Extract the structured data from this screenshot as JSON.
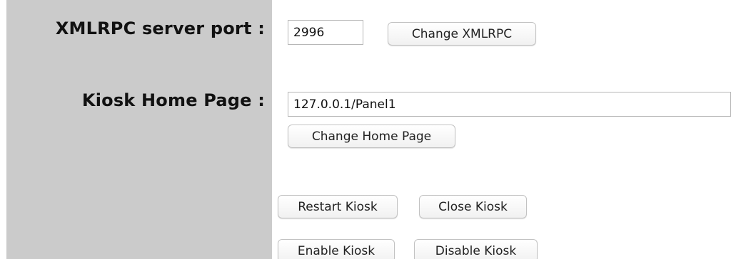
{
  "settings": {
    "xmlrpc_port": {
      "label": "XMLRPC server port :",
      "value": "2996",
      "button_label": "Change XMLRPC"
    },
    "home_page": {
      "label": "Kiosk Home Page :",
      "value": "127.0.0.1/Panel1",
      "button_label": "Change Home Page"
    }
  },
  "actions": {
    "restart_label": "Restart Kiosk",
    "close_label": "Close Kiosk",
    "enable_label": "Enable Kiosk",
    "disable_label": "Disable Kiosk"
  },
  "colors": {
    "label_column_bg": "#cbcbcb",
    "page_bg": "#ffffff"
  }
}
